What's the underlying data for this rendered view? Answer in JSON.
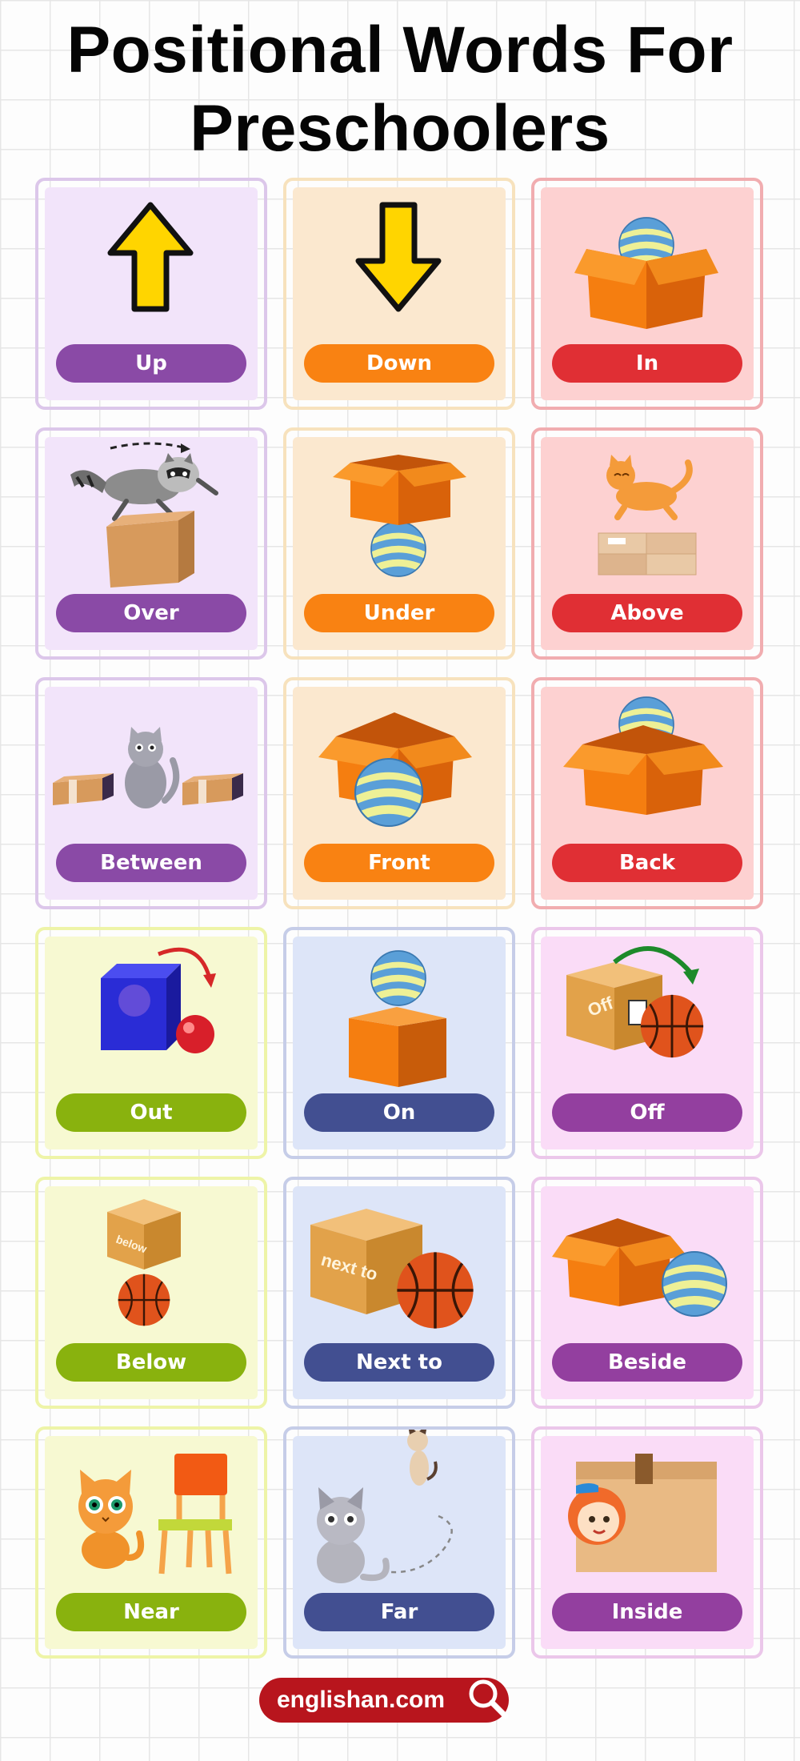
{
  "title": {
    "line1": "Positional Words For",
    "line2": "Preschoolers"
  },
  "cards": [
    {
      "label": "Up",
      "icon": "up-arrow-icon",
      "theme": "purple"
    },
    {
      "label": "Down",
      "icon": "down-arrow-icon",
      "theme": "orange"
    },
    {
      "label": "In",
      "icon": "ball-in-box-icon",
      "theme": "red"
    },
    {
      "label": "Over",
      "icon": "raccoon-over-box-icon",
      "theme": "purple"
    },
    {
      "label": "Under",
      "icon": "ball-under-box-icon",
      "theme": "orange"
    },
    {
      "label": "Above",
      "icon": "cat-above-boxes-icon",
      "theme": "red"
    },
    {
      "label": "Between",
      "icon": "cat-between-boxes-icon",
      "theme": "purple"
    },
    {
      "label": "Front",
      "icon": "ball-in-front-of-box-icon",
      "theme": "orange"
    },
    {
      "label": "Back",
      "icon": "ball-behind-box-icon",
      "theme": "red"
    },
    {
      "label": "Out",
      "icon": "ball-out-of-cube-icon",
      "theme": "green"
    },
    {
      "label": "On",
      "icon": "ball-on-box-icon",
      "theme": "blue"
    },
    {
      "label": "Off",
      "icon": "ball-off-box-icon",
      "theme": "pink"
    },
    {
      "label": "Below",
      "icon": "ball-below-box-icon",
      "theme": "green"
    },
    {
      "label": "Next to",
      "icon": "ball-next-to-box-icon",
      "theme": "blue"
    },
    {
      "label": "Beside",
      "icon": "ball-beside-box-icon",
      "theme": "pink"
    },
    {
      "label": "Near",
      "icon": "cat-near-chair-icon",
      "theme": "green"
    },
    {
      "label": "Far",
      "icon": "cat-far-from-cat-icon",
      "theme": "blue"
    },
    {
      "label": "Inside",
      "icon": "girl-inside-box-icon",
      "theme": "pink"
    }
  ],
  "box_texts": {
    "off": "Off",
    "below": "below",
    "next_to": "next to"
  },
  "footer": {
    "site": "englishan.com",
    "icon": "magnifier-icon"
  },
  "colors": {
    "purple": "#8a4aa6",
    "orange": "#f98212",
    "red": "#e02f34",
    "green": "#89b20e",
    "blue": "#424f91",
    "pink": "#933f9f"
  }
}
